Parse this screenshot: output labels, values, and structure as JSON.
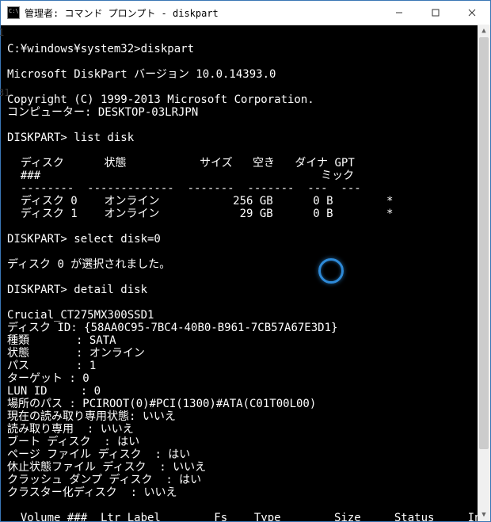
{
  "window": {
    "title": "管理者: コマンド プロンプト - diskpart"
  },
  "edge_labels": {
    "a": "1",
    "b": "31"
  },
  "terminal": {
    "prompt_line": "C:¥windows¥system32>diskpart",
    "blank": "",
    "version_line": "Microsoft DiskPart バージョン 10.0.14393.0",
    "copyright_line": "Copyright (C) 1999-2013 Microsoft Corporation.",
    "computer_line": "コンピューター: DESKTOP-03LRJPN",
    "cmd_list_disk": "DISKPART> list disk",
    "table_header": "  ディスク      状態           サイズ   空き   ダイナ GPT",
    "table_header2": "  ###                                          ミック",
    "table_divider": "  --------  -------------  -------  -------  ---  ---",
    "disk_row_0": "  ディスク 0    オンライン           256 GB      0 B        *",
    "disk_row_1": "  ディスク 1    オンライン            29 GB      0 B        *",
    "cmd_select_disk": "DISKPART> select disk=0",
    "selected_msg": "ディスク 0 が選択されました。",
    "cmd_detail_disk": "DISKPART> detail disk",
    "detail_model": "Crucial_CT275MX300SSD1",
    "detail_id": "ディスク ID: {58AA0C95-7BC4-40B0-B961-7CB57A67E3D1}",
    "detail_type": "種類       : SATA",
    "detail_state": "状態       : オンライン",
    "detail_path": "パス       : 1",
    "detail_target": "ターゲット : 0",
    "detail_lunid": "LUN ID     : 0",
    "detail_loc": "場所のパス : PCIROOT(0)#PCI(1300)#ATA(C01T00L00)",
    "detail_readcur": "現在の読み取り専用状態: いいえ",
    "detail_readonly": "読み取り専用  : いいえ",
    "detail_boot": "ブート ディスク  : はい",
    "detail_page": "ページ ファイル ディスク  : はい",
    "detail_hiber": "休止状態ファイル ディスク  : いいえ",
    "detail_crash": "クラッシュ ダンプ ディスク  : はい",
    "detail_cluster": "クラスター化ディスク  : いいえ",
    "vol_header": "  Volume ###  Ltr Label        Fs    Type        Size     Status     Info"
  },
  "disk_table": {
    "columns": [
      "ディスク ###",
      "状態",
      "サイズ",
      "空き",
      "ダイナミック",
      "GPT"
    ],
    "rows": [
      {
        "id": "ディスク 0",
        "state": "オンライン",
        "size": "256 GB",
        "free": "0 B",
        "dynamic": "",
        "gpt": "*"
      },
      {
        "id": "ディスク 1",
        "state": "オンライン",
        "size": "29 GB",
        "free": "0 B",
        "dynamic": "",
        "gpt": "*"
      }
    ]
  }
}
